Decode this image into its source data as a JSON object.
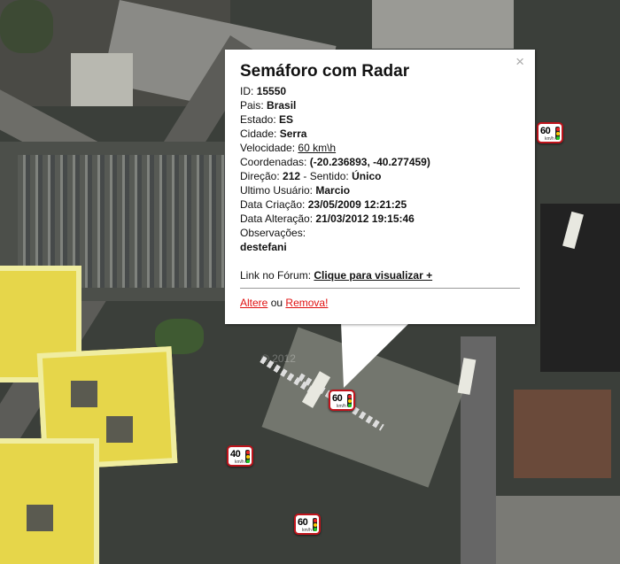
{
  "popup": {
    "title": "Semáforo com Radar",
    "close_symbol": "×",
    "fields": [
      {
        "label": "ID:",
        "value": "15550"
      },
      {
        "label": "Pais:",
        "value": "Brasil"
      },
      {
        "label": "Estado:",
        "value": "ES"
      },
      {
        "label": "Cidade:",
        "value": "Serra"
      }
    ],
    "speed_label": "Velocidade:",
    "speed_value": "60 km\\h",
    "coords_label": "Coordenadas:",
    "coords_value": "(-20.236893, -40.277459)",
    "direction_label": "Direção:",
    "direction_value": "212",
    "sense_label": "- Sentido:",
    "sense_value": "Único",
    "last_user_label": "Ultimo Usuário:",
    "last_user_value": "Marcio",
    "created_label": "Data Criação:",
    "created_value": "23/05/2009 12:21:25",
    "changed_label": "Data Alteração:",
    "changed_value": "21/03/2012 19:15:46",
    "notes_label": "Observações:",
    "notes_value": "destefani",
    "forum_label": "Link no Fórum:",
    "forum_link": "Clique para visualizar +",
    "edit_link": "Altere",
    "or_text": "ou",
    "remove_link": "Remova!"
  },
  "markers": [
    {
      "speed": "60",
      "name": "radar-marker-60-right"
    },
    {
      "speed": "60",
      "name": "radar-marker-60-selected"
    },
    {
      "speed": "40",
      "name": "radar-marker-40"
    },
    {
      "speed": "60",
      "name": "radar-marker-60-bottom"
    }
  ],
  "marker_unit": "km/h",
  "watermark": "© 2012"
}
